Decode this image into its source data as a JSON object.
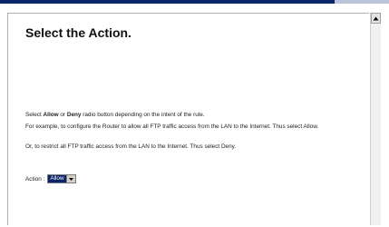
{
  "page": {
    "title": "Select the Action."
  },
  "instructions": {
    "p1_prefix": "Select ",
    "p1_allow": "Allow",
    "p1_or": " or ",
    "p1_deny": "Deny",
    "p1_suffix": " radio button depending on the intent of the rule.",
    "p2": "For example, to configure the Router to allow all FTP traffic access from the LAN to the Internet. Thus select Allow.",
    "p3": "Or, to restrict all FTP traffic access from the LAN to the Internet. Thus select Deny."
  },
  "action": {
    "label": "Action :",
    "selected": "Allow"
  },
  "icons": {
    "scroll_up": "scroll-up-arrow-icon",
    "dropdown": "chevron-down-icon"
  },
  "colors": {
    "selection": "#0a246a",
    "title_bar": "#0a246a"
  }
}
